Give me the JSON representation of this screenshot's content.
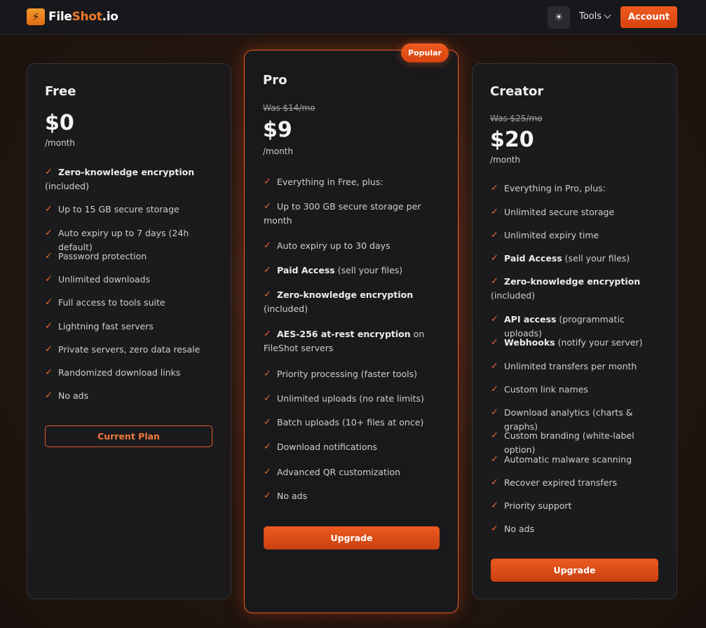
{
  "header": {
    "logo_icon": "⚡",
    "logo_part1": "File",
    "logo_part2": "Shot",
    "logo_part3": ".io",
    "theme_icon": "☀",
    "tools_label": "Tools",
    "account_label": "Account"
  },
  "colors": {
    "accent": "#ea5a1f",
    "background": "#1a120e",
    "card": "#1b1b1e"
  },
  "plans": {
    "free": {
      "name": "Free",
      "price": "$0",
      "period": "/month",
      "features": [
        {
          "bold": "Zero-knowledge encryption",
          "text": "(included)"
        },
        {
          "bold": "",
          "text": "Up to 15 GB secure storage"
        },
        {
          "bold": "",
          "text": "Auto expiry up to 7 days (24h default)"
        },
        {
          "bold": "",
          "text": "Password protection"
        },
        {
          "bold": "",
          "text": "Unlimited downloads"
        },
        {
          "bold": "",
          "text": "Full access to tools suite"
        },
        {
          "bold": "",
          "text": "Lightning fast servers"
        },
        {
          "bold": "",
          "text": "Private servers, zero data resale"
        },
        {
          "bold": "",
          "text": "Randomized download links"
        },
        {
          "bold": "",
          "text": "No ads"
        }
      ],
      "button": "Current Plan"
    },
    "pro": {
      "badge": "Popular",
      "name": "Pro",
      "was": "Was $14/mo",
      "price": "$9",
      "period": "/month",
      "features": [
        {
          "bold": "",
          "text": "Everything in Free, plus:"
        },
        {
          "bold": "",
          "text": "Up to 300 GB secure storage per month"
        },
        {
          "bold": "",
          "text": "Auto expiry up to 30 days"
        },
        {
          "bold": "Paid Access",
          "text": "(sell your files)"
        },
        {
          "bold": "Zero-knowledge encryption",
          "text": "(included)"
        },
        {
          "bold": "AES-256 at-rest encryption",
          "text": "on FileShot servers"
        },
        {
          "bold": "",
          "text": "Priority processing (faster tools)"
        },
        {
          "bold": "",
          "text": "Unlimited uploads (no rate limits)"
        },
        {
          "bold": "",
          "text": "Batch uploads (10+ files at once)"
        },
        {
          "bold": "",
          "text": "Download notifications"
        },
        {
          "bold": "",
          "text": "Advanced QR customization"
        },
        {
          "bold": "",
          "text": "No ads"
        }
      ],
      "button": "Upgrade"
    },
    "creator": {
      "name": "Creator",
      "was": "Was $25/mo",
      "price": "$20",
      "period": "/month",
      "features": [
        {
          "bold": "",
          "text": "Everything in Pro, plus:"
        },
        {
          "bold": "",
          "text": "Unlimited secure storage"
        },
        {
          "bold": "",
          "text": "Unlimited expiry time"
        },
        {
          "bold": "Paid Access",
          "text": "(sell your files)"
        },
        {
          "bold": "Zero-knowledge encryption",
          "text": "(included)"
        },
        {
          "bold": "API access",
          "text": "(programmatic uploads)"
        },
        {
          "bold": "Webhooks",
          "text": "(notify your server)"
        },
        {
          "bold": "",
          "text": "Unlimited transfers per month"
        },
        {
          "bold": "",
          "text": "Custom link names"
        },
        {
          "bold": "",
          "text": "Download analytics (charts & graphs)"
        },
        {
          "bold": "",
          "text": "Custom branding (white-label option)"
        },
        {
          "bold": "",
          "text": "Automatic malware scanning"
        },
        {
          "bold": "",
          "text": "Recover expired transfers"
        },
        {
          "bold": "",
          "text": "Priority support"
        },
        {
          "bold": "",
          "text": "No ads"
        }
      ],
      "button": "Upgrade"
    }
  }
}
